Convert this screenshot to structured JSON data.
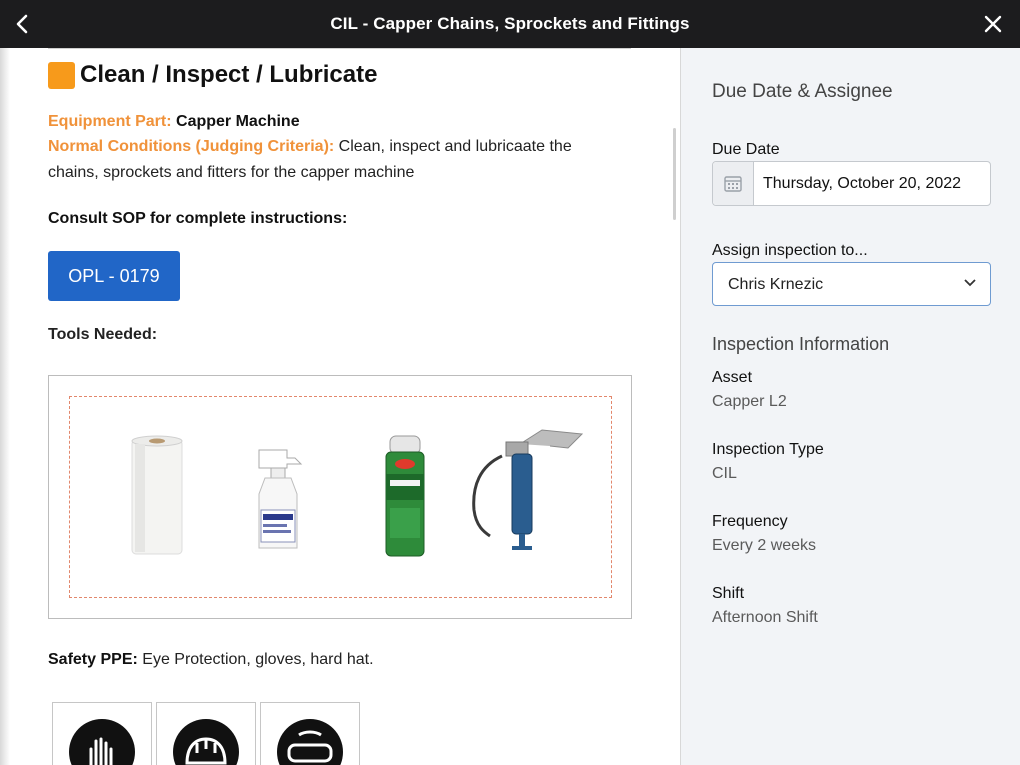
{
  "header": {
    "title": "CIL - Capper Chains, Sprockets and Fittings",
    "back_icon": "chevron-left-icon",
    "close_icon": "close-icon"
  },
  "task": {
    "heading": "Clean / Inspect / Lubricate",
    "heading_icon": "orange-square-icon",
    "equipment_label": "Equipment Part:",
    "equipment_value": "Capper Machine",
    "conditions_label": "Normal Conditions (Judging Criteria):",
    "conditions_value": "Clean, inspect and lubricaate the chains, sprockets and fitters for the capper machine",
    "sop_text": "Consult SOP for complete instructions:",
    "opl_button": "OPL - 0179",
    "tools_label": "Tools Needed:",
    "tools": [
      "paper-towel-roll",
      "spray-bottle",
      "chain-lube-can",
      "grease-gun"
    ],
    "safety_label": "Safety PPE:",
    "safety_value": "Eye Protection, gloves, hard hat.",
    "ppe_icons": [
      "gloves-icon",
      "hard-hat-icon",
      "safety-goggles-icon"
    ]
  },
  "sidebar": {
    "due_heading": "Due Date & Assignee",
    "due_date_label": "Due Date",
    "due_date_value": "Thursday, October 20, 2022",
    "assign_label": "Assign inspection to...",
    "assign_value": "Chris Krnezic",
    "info_heading": "Inspection Information",
    "fields": [
      {
        "label": "Asset",
        "value": "Capper L2"
      },
      {
        "label": "Inspection Type",
        "value": "CIL"
      },
      {
        "label": "Frequency",
        "value": "Every 2 weeks"
      },
      {
        "label": "Shift",
        "value": "Afternoon Shift"
      }
    ]
  },
  "colors": {
    "accent": "#2166c7",
    "orange": "#f0923a",
    "topbar": "#1c1c1e"
  }
}
